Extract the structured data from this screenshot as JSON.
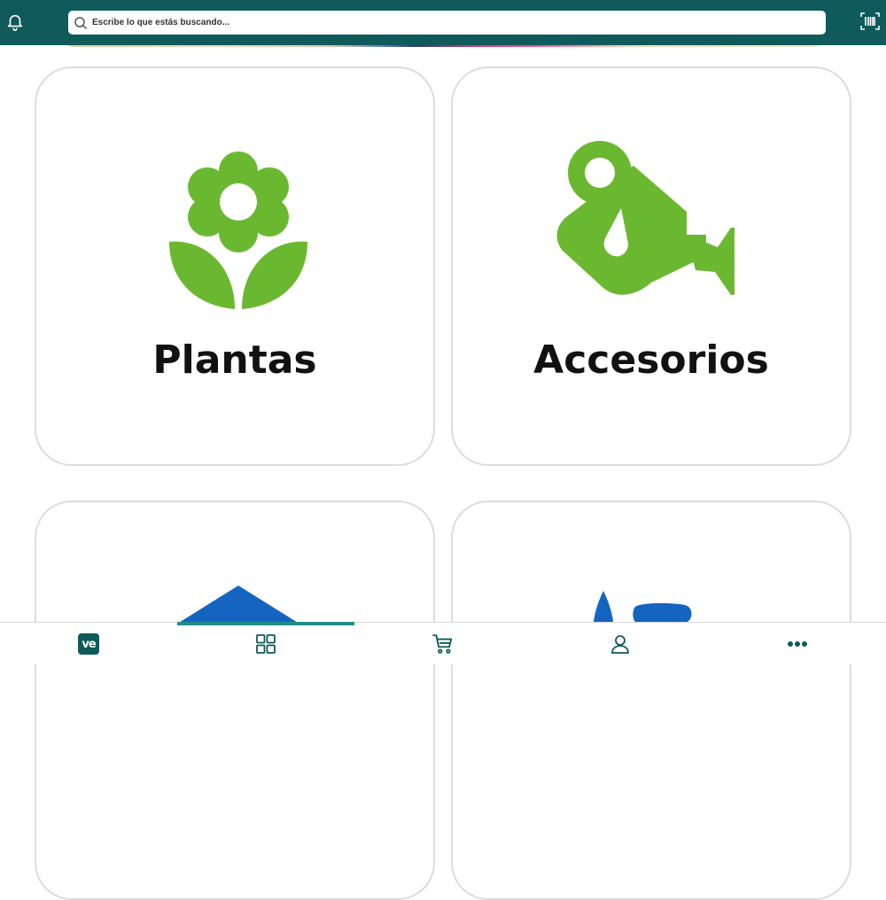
{
  "header": {
    "search_placeholder": "Escribe lo que estás buscando..."
  },
  "categories": [
    {
      "label": "Plantas",
      "icon": "flower-icon",
      "color": "#6ab82f"
    },
    {
      "label": "Accesorios",
      "icon": "watering-can-icon",
      "color": "#6ab82f"
    },
    {
      "label": "",
      "icon": "house-roof-icon",
      "color": "#1565c0"
    },
    {
      "label": "",
      "icon": "spray-bottle-icon",
      "color": "#1565c0"
    }
  ],
  "bottom_nav": {
    "items": [
      {
        "id": "home",
        "icon": "ve-logo-icon",
        "logo_text": "ve"
      },
      {
        "id": "categories",
        "icon": "grid-icon",
        "active": true
      },
      {
        "id": "cart",
        "icon": "cart-icon"
      },
      {
        "id": "account",
        "icon": "user-icon"
      },
      {
        "id": "more",
        "icon": "more-dots-icon"
      }
    ]
  },
  "colors": {
    "header": "#0f5a5a",
    "active_tab": "#1c8f86",
    "icon_dark": "#0f5a5a"
  }
}
